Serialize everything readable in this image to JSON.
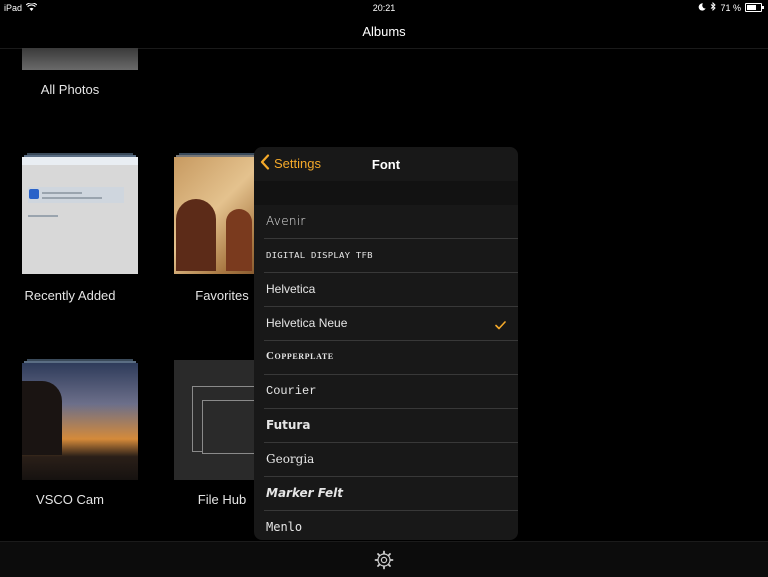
{
  "status": {
    "device": "iPad",
    "time": "20:21",
    "battery": "71 %",
    "battery_level": 0.71
  },
  "nav": {
    "title": "Albums"
  },
  "albums": [
    {
      "label": "All Photos"
    },
    {
      "label": "Recently Added"
    },
    {
      "label": "Favorites"
    },
    {
      "label": "VSCO Cam"
    },
    {
      "label": "File Hub"
    }
  ],
  "popover": {
    "back_label": "Settings",
    "title": "Font",
    "fonts": [
      {
        "name": "Avenir"
      },
      {
        "name": "DIGITAL DISPLAY TFB"
      },
      {
        "name": "Helvetica"
      },
      {
        "name": "Helvetica Neue",
        "selected": true
      },
      {
        "name": "Copperplate"
      },
      {
        "name": "Courier"
      },
      {
        "name": "Futura"
      },
      {
        "name": "Georgia"
      },
      {
        "name": "Marker Felt"
      },
      {
        "name": "Menlo"
      }
    ]
  },
  "colors": {
    "accent": "#f4a92a",
    "background": "#000000",
    "popover": "#181818"
  },
  "icons": {
    "bottom": "gear-icon",
    "back": "chevron-left-icon",
    "check": "checkmark-icon"
  }
}
